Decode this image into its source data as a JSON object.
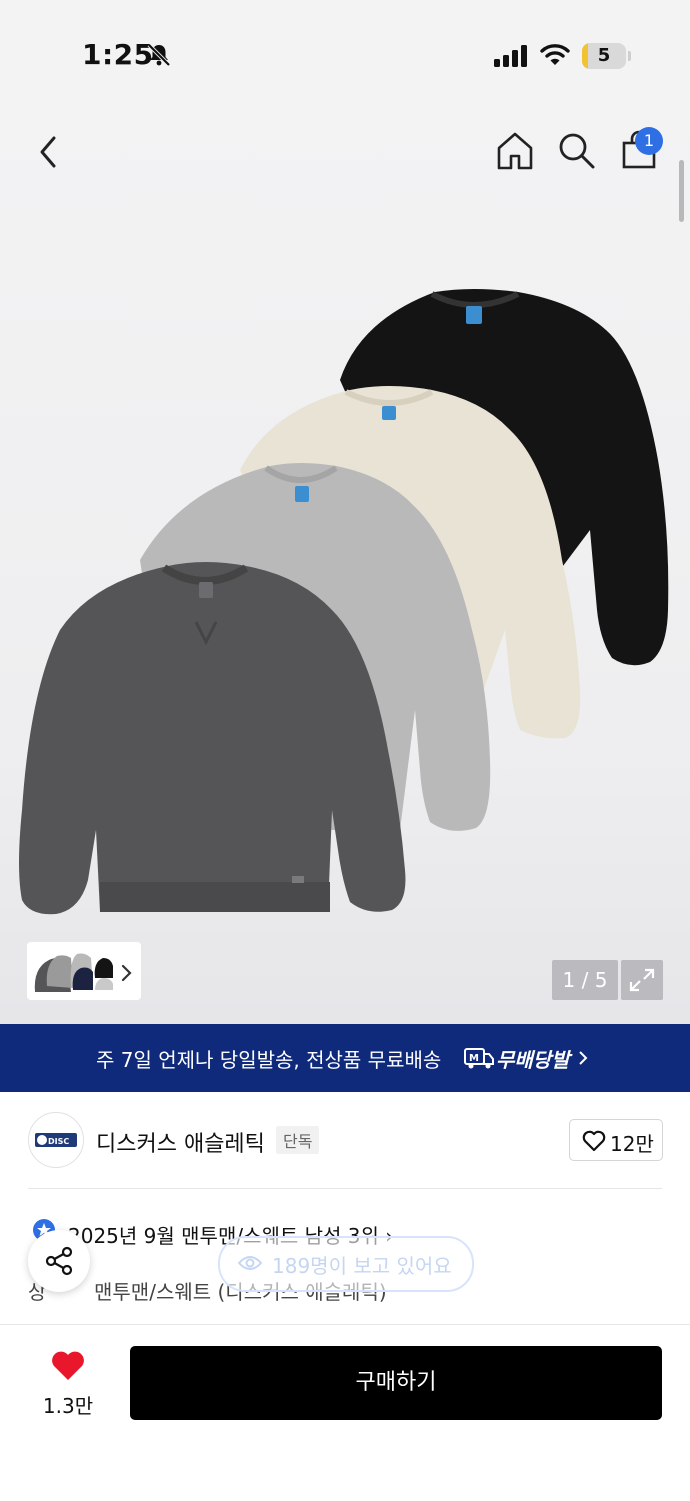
{
  "status": {
    "time": "1:25",
    "battery": "5",
    "bell_icon": "bell-slash-icon",
    "signal_icon": "signal-icon",
    "wifi_icon": "wifi-icon"
  },
  "nav": {
    "back_icon": "chevron-left-icon",
    "home_icon": "home-icon",
    "search_icon": "search-icon",
    "bag_icon": "shopping-bag-icon",
    "cart_count": "1"
  },
  "gallery": {
    "counter": "1 / 5",
    "expand_icon": "expand-icon"
  },
  "banner": {
    "text": "주 7일 언제나 당일발송, 전상품 무료배송",
    "brand": "무배당발",
    "bg_color": "#0f2a7a"
  },
  "brand": {
    "name": "디스커스 애슬레틱",
    "badge": "단독",
    "likes": "12만"
  },
  "ranking": {
    "text": "2025년 9월 맨투맨/스웨트 남성 3위"
  },
  "viewers": {
    "text": "189명이 보고 있어요"
  },
  "product": {
    "category_prefix": "상",
    "category": "맨투맨/스웨트 (디스커스 애슬레틱)"
  },
  "bottom": {
    "wish_count": "1.3만",
    "buy_label": "구매하기",
    "accent": "#e8172b"
  },
  "colors": {
    "sweatshirts": [
      "#111111",
      "#e9e3d6",
      "#b9b9b9",
      "#555557"
    ]
  }
}
